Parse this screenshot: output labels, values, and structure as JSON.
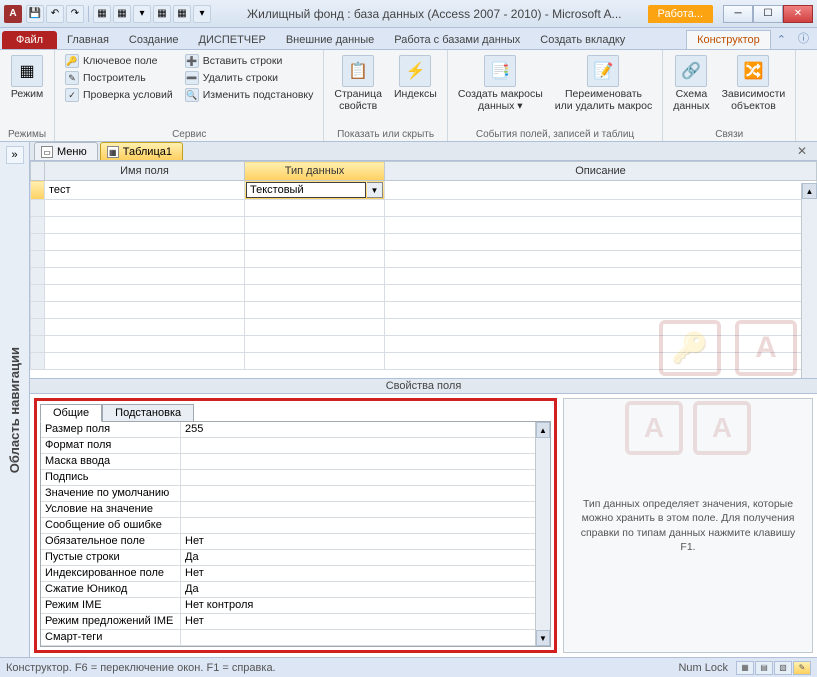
{
  "titlebar": {
    "app_letter": "A",
    "title": "Жилищный фонд : база данных (Access 2007 - 2010)  -  Microsoft A...",
    "context_tab": "Работа..."
  },
  "ribbon": {
    "tabs": {
      "file": "Файл",
      "home": "Главная",
      "create": "Создание",
      "dispatcher": "ДИСПЕТЧЕР",
      "external": "Внешние данные",
      "db": "Работа с базами данных",
      "new_tab": "Создать вкладку",
      "design": "Конструктор"
    },
    "groups": {
      "modes": {
        "label": "Режимы",
        "view": "Режим"
      },
      "service": {
        "label": "Сервис",
        "key_field": "Ключевое поле",
        "builder": "Построитель",
        "test_rules": "Проверка условий",
        "insert_rows": "Вставить строки",
        "delete_rows": "Удалить строки",
        "modify_lookup": "Изменить подстановку"
      },
      "show_hide": {
        "label": "Показать или скрыть",
        "property_sheet": "Страница\nсвойств",
        "indexes": "Индексы"
      },
      "events": {
        "label": "События полей, записей и таблиц",
        "create_macros": "Создать макросы\nданных ▾",
        "rename_delete": "Переименовать\nили удалить макрос"
      },
      "relations": {
        "label": "Связи",
        "schema": "Схема\nданных",
        "deps": "Зависимости\nобъектов"
      }
    }
  },
  "nav_pane": {
    "label": "Область навигации"
  },
  "doc_tabs": {
    "menu": "Меню",
    "table1": "Таблица1"
  },
  "grid": {
    "headers": {
      "name": "Имя поля",
      "type": "Тип данных",
      "desc": "Описание"
    },
    "row1": {
      "name": "тест",
      "type": "Текстовый"
    }
  },
  "props": {
    "header": "Свойства поля",
    "tabs": {
      "general": "Общие",
      "lookup": "Подстановка"
    },
    "rows": [
      {
        "label": "Размер поля",
        "value": "255"
      },
      {
        "label": "Формат поля",
        "value": ""
      },
      {
        "label": "Маска ввода",
        "value": ""
      },
      {
        "label": "Подпись",
        "value": ""
      },
      {
        "label": "Значение по умолчанию",
        "value": ""
      },
      {
        "label": "Условие на значение",
        "value": ""
      },
      {
        "label": "Сообщение об ошибке",
        "value": ""
      },
      {
        "label": "Обязательное поле",
        "value": "Нет"
      },
      {
        "label": "Пустые строки",
        "value": "Да"
      },
      {
        "label": "Индексированное поле",
        "value": "Нет"
      },
      {
        "label": "Сжатие Юникод",
        "value": "Да"
      },
      {
        "label": "Режим IME",
        "value": "Нет контроля"
      },
      {
        "label": "Режим предложений IME",
        "value": "Нет"
      },
      {
        "label": "Смарт-теги",
        "value": ""
      }
    ],
    "help_text": "Тип данных определяет значения, которые можно хранить в этом поле. Для получения справки по типам данных нажмите клавишу F1."
  },
  "statusbar": {
    "left": "Конструктор.  F6 = переключение окон.  F1 = справка.",
    "numlock": "Num Lock"
  }
}
